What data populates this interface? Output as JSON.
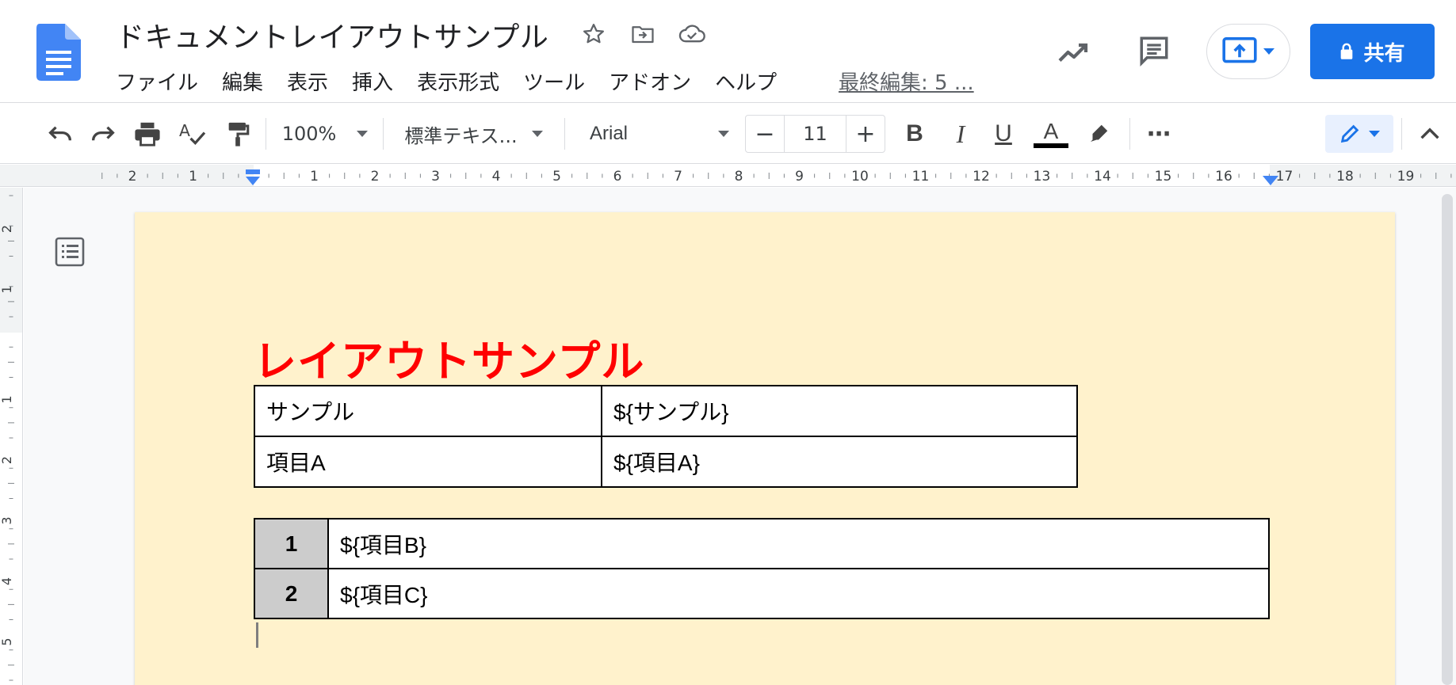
{
  "header": {
    "title": "ドキュメントレイアウトサンプル",
    "title_icons": [
      "star-icon",
      "move-to-folder-icon",
      "cloud-saved-icon"
    ],
    "menus": [
      "ファイル",
      "編集",
      "表示",
      "挿入",
      "表示形式",
      "ツール",
      "アドオン",
      "ヘルプ"
    ],
    "last_edit": "最終編集: 5 ...",
    "share_label": "共有",
    "icons": [
      "activity-trend-icon",
      "comments-icon",
      "present-icon",
      "lock-icon"
    ]
  },
  "toolbar": {
    "zoom": "100%",
    "style": "標準テキス...",
    "font": "Arial",
    "font_size": "11",
    "minus": "−",
    "plus": "+",
    "more": "⋯",
    "text_color_hex": "#000000"
  },
  "ruler": {
    "h_labels": [
      "2",
      "1",
      "1",
      "2",
      "3",
      "4",
      "5",
      "6",
      "7",
      "8",
      "9",
      "10",
      "11",
      "12",
      "13",
      "14",
      "15",
      "16",
      "17",
      "18",
      "19"
    ],
    "v_labels": [
      "2",
      "1",
      "1",
      "2",
      "3",
      "4",
      "5"
    ]
  },
  "document": {
    "heading": "レイアウトサンプル",
    "heading_color": "#ff0000",
    "page_color": "#fff2cc",
    "table1": [
      [
        "サンプル",
        "${サンプル}"
      ],
      [
        "項目A",
        "${項目A}"
      ]
    ],
    "table2": [
      [
        "1",
        "${項目B}"
      ],
      [
        "2",
        "${項目C}"
      ]
    ]
  },
  "colors": {
    "accent": "#1a73e8",
    "docs_blue": "#4285f4"
  }
}
